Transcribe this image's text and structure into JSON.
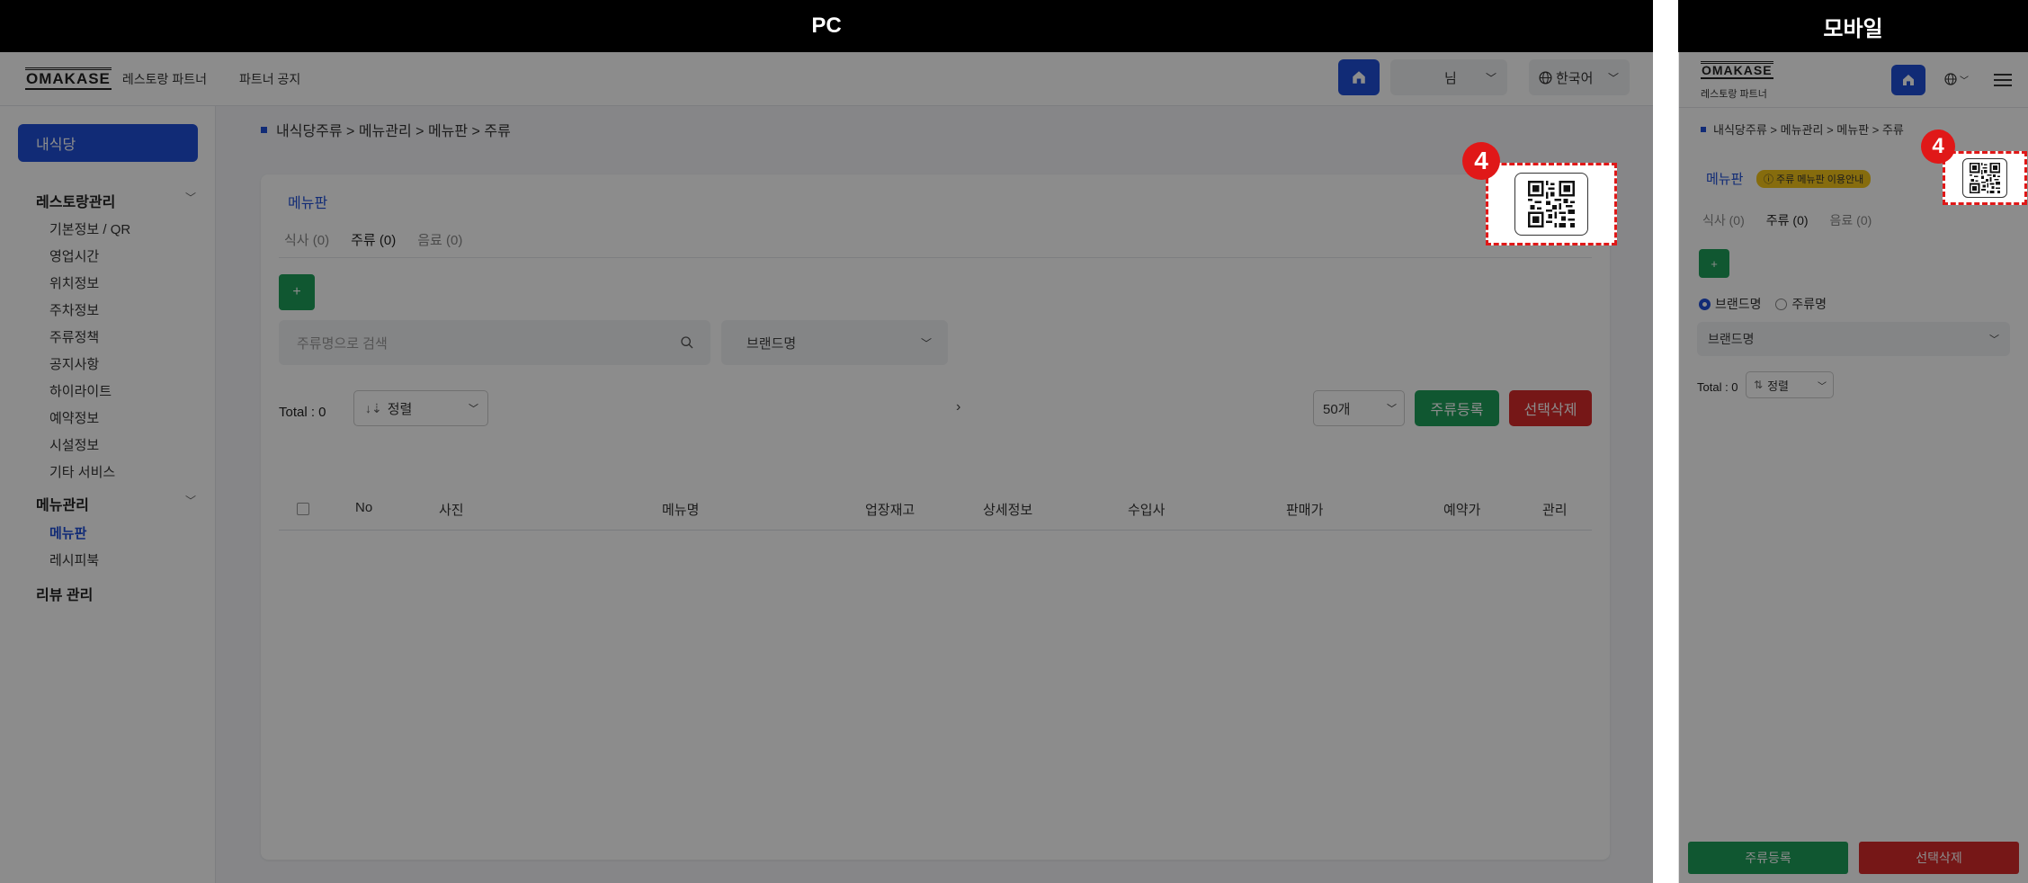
{
  "labels": {
    "pc": "PC",
    "mobile": "모바일"
  },
  "app": {
    "logo": "OMAKASE",
    "logo_sub": "레스토랑 파트너",
    "partner_notice": "파트너 공지",
    "user_suffix": "님",
    "language": "한국어"
  },
  "sidebar": {
    "my_store": "내식당",
    "restaurant_group": "레스토랑관리",
    "restaurant_items": [
      "기본정보 / QR",
      "영업시간",
      "위치정보",
      "주차정보",
      "주류정책",
      "공지사항",
      "하이라이트",
      "예약정보",
      "시설정보",
      "기타 서비스"
    ],
    "menu_group": "메뉴관리",
    "menu_items": [
      "메뉴판",
      "레시피북"
    ],
    "review": "리뷰 관리"
  },
  "breadcrumb": "내식당주류 > 메뉴관리 > 메뉴판 > 주류",
  "content": {
    "card_title": "메뉴판",
    "tabs": [
      "식사 (0)",
      "주류 (0)",
      "음료 (0)"
    ],
    "add_label": "+",
    "search_placeholder": "주류명으로 검색",
    "brand_select": "브랜드명",
    "total": "Total : 0",
    "sort_label": "정렬",
    "page_size": "50개",
    "register_button": "주류등록",
    "delete_button": "선택삭제",
    "columns": [
      "No",
      "사진",
      "메뉴명",
      "업장재고",
      "상세정보",
      "수입사",
      "판매가",
      "예약가",
      "관리"
    ]
  },
  "mobile": {
    "logo_sub": "레스토랑 파트너",
    "breadcrumb": "내식당주류 > 메뉴관리 > 메뉴판 > 주류",
    "card_title": "메뉴판",
    "info_badge": "ⓘ 주류 메뉴판 이용안내",
    "tabs": [
      "식사 (0)",
      "주류 (0)",
      "음료 (0)"
    ],
    "radio_brand": "브랜드명",
    "radio_liquor": "주류명",
    "brand_select": "브랜드명",
    "total": "Total : 0",
    "sort_label": "정렬",
    "register_button": "주류등록",
    "delete_button": "선택삭제"
  },
  "callout_number": "4",
  "colors": {
    "primary": "#1f4fd8",
    "green": "#1e9e5a",
    "red": "#d72b2b",
    "callout": "#e01818"
  }
}
